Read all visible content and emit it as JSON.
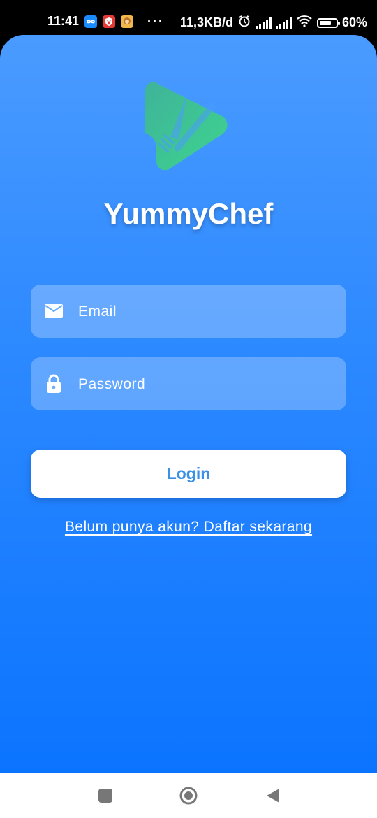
{
  "status_bar": {
    "time": "11:41",
    "network_speed": "11,3KB/d",
    "overflow": "···",
    "battery": "60%",
    "icons": [
      "infinity-app-icon",
      "shield-app-icon",
      "game-app-icon",
      "alarm-icon",
      "signal-icon",
      "signal-icon",
      "wifi-icon",
      "battery-icon"
    ]
  },
  "app": {
    "title": "YummyChef",
    "logo": "chef-knife-fork-logo"
  },
  "form": {
    "email": {
      "placeholder": "Email",
      "value": "",
      "icon": "mail-icon"
    },
    "password": {
      "placeholder": "Password",
      "value": "",
      "icon": "lock-icon"
    },
    "login_label": "Login",
    "register_link": "Belum punya akun? Daftar sekarang"
  },
  "nav_bar": {
    "icons": [
      "recent-apps-icon",
      "home-icon",
      "back-icon"
    ]
  },
  "colors": {
    "gradient_top": "#4a9bff",
    "gradient_bottom": "#0b74ff",
    "button_text": "#3a8fe6",
    "logo_green": "#3ed48e"
  }
}
